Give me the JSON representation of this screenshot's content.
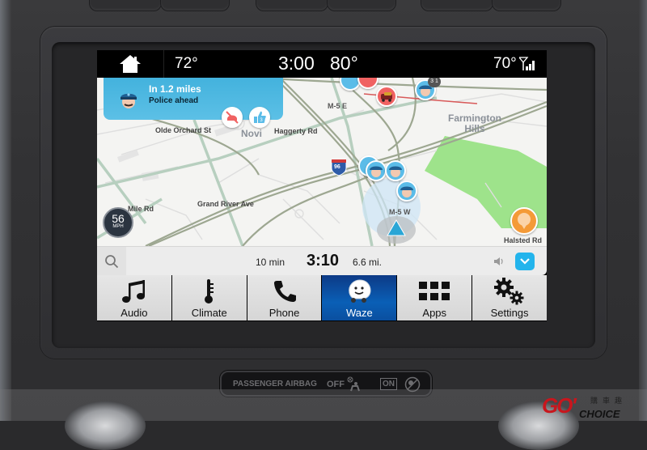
{
  "status_bar": {
    "home_icon": "home-icon",
    "outside_temp_left": "72°",
    "clock": "3:00",
    "cabin_temp_center": "80°",
    "temp_right": "70°",
    "signal_icon": "signal-strength-icon"
  },
  "map": {
    "alert": {
      "icon": "police-officer-icon",
      "distance": "In 1.2 miles",
      "message": "Police ahead",
      "actions": [
        {
          "icon": "not-there-icon",
          "color": "#f06262"
        },
        {
          "icon": "thumbs-up-icon",
          "count": "3",
          "color": "#5bbce8"
        }
      ]
    },
    "labels": {
      "olde_orchard": "Olde Orchard St",
      "novi": "Novi",
      "haggerty": "Haggerty Rd",
      "m5e": "M-5 E",
      "farmington_hills_1": "Farmington",
      "farmington_hills_2": "Hills",
      "interstate": "96",
      "mile_rd": "Mile Rd",
      "grand_river": "Grand River Ave",
      "m5w": "M-5 W",
      "halsted": "Halsted Rd",
      "cluster_count": "3 1"
    },
    "speed": {
      "value": "56",
      "unit": "MPH"
    },
    "colors": {
      "park": "#9ee38b",
      "alert_bg": "#4bb6e0",
      "pin_blue": "#5bbce8",
      "pin_red": "#f06262",
      "pin_orange": "#f49a37",
      "current_position": "#2aa6d6"
    }
  },
  "route_bar": {
    "search_icon": "search-icon",
    "eta_minutes": "10 min",
    "arrival_time": "3:10",
    "distance": "6.6 mi.",
    "sound_icon": "speaker-icon",
    "expand_icon": "chevron-down-icon"
  },
  "tabs": [
    {
      "label": "Audio",
      "icon": "music-note-icon",
      "active": false
    },
    {
      "label": "Climate",
      "icon": "thermometer-icon",
      "active": false
    },
    {
      "label": "Phone",
      "icon": "phone-icon",
      "active": false
    },
    {
      "label": "Waze",
      "icon": "waze-icon",
      "active": true
    },
    {
      "label": "Apps",
      "icon": "apps-grid-icon",
      "active": false
    },
    {
      "label": "Settings",
      "icon": "gears-icon",
      "active": false
    }
  ],
  "airbag_panel": {
    "label": "PASSENGER AIRBAG",
    "off": "OFF",
    "on": "ON"
  },
  "watermark": {
    "go": "GO'",
    "choice": "CHOICE",
    "chinese": "購車趣"
  }
}
